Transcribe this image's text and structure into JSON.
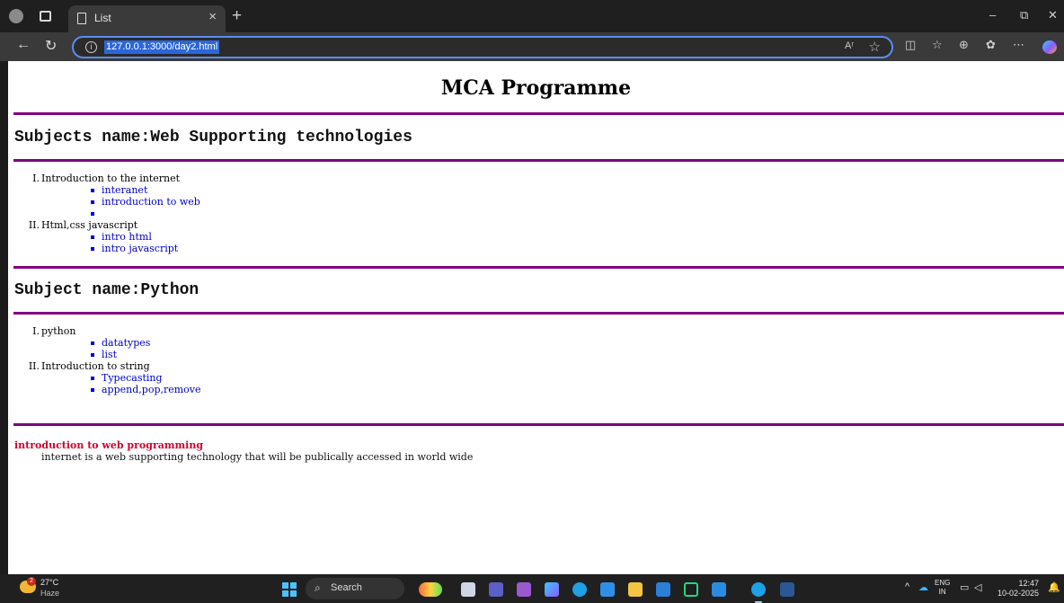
{
  "browser": {
    "tab_title": "List",
    "tab_close": "×",
    "new_tab": "+",
    "url": "127.0.0.1:3000/day2.html",
    "read_aloud": "Aʳ",
    "window_controls": {
      "minimize": "–",
      "restore": "⧉",
      "close": "✕"
    }
  },
  "page": {
    "title": "MCA Programme",
    "sections": [
      {
        "heading": "Subjects name:Web Supporting technologies",
        "units": [
          {
            "num": "I.",
            "label": "Introduction to the internet",
            "topics": [
              "interanet",
              "introduction to web",
              ""
            ]
          },
          {
            "num": "II.",
            "label": "Html,css javascript",
            "topics": [
              "intro html",
              "intro javascript"
            ]
          }
        ]
      },
      {
        "heading": "Subject name:Python",
        "units": [
          {
            "num": "I.",
            "label": "python",
            "topics": [
              "datatypes",
              "list"
            ]
          },
          {
            "num": "II.",
            "label": "Introduction to string",
            "topics": [
              "Typecasting",
              "append,pop,remove"
            ]
          }
        ]
      }
    ],
    "definition": {
      "term": "introduction to web programming",
      "description": "internet is a web supporting technology that will be publically accessed in world wide"
    }
  },
  "taskbar": {
    "weather_temp": "27°C",
    "weather_desc": "Haze",
    "weather_badge": "2",
    "search_label": "Search",
    "language_1": "ENG",
    "language_2": "IN",
    "time": "12:47",
    "date": "10-02-2025"
  },
  "colors": {
    "rule": "#800080",
    "link": "#0000cc",
    "term": "#d3002d",
    "address_border": "#5a8df0"
  }
}
